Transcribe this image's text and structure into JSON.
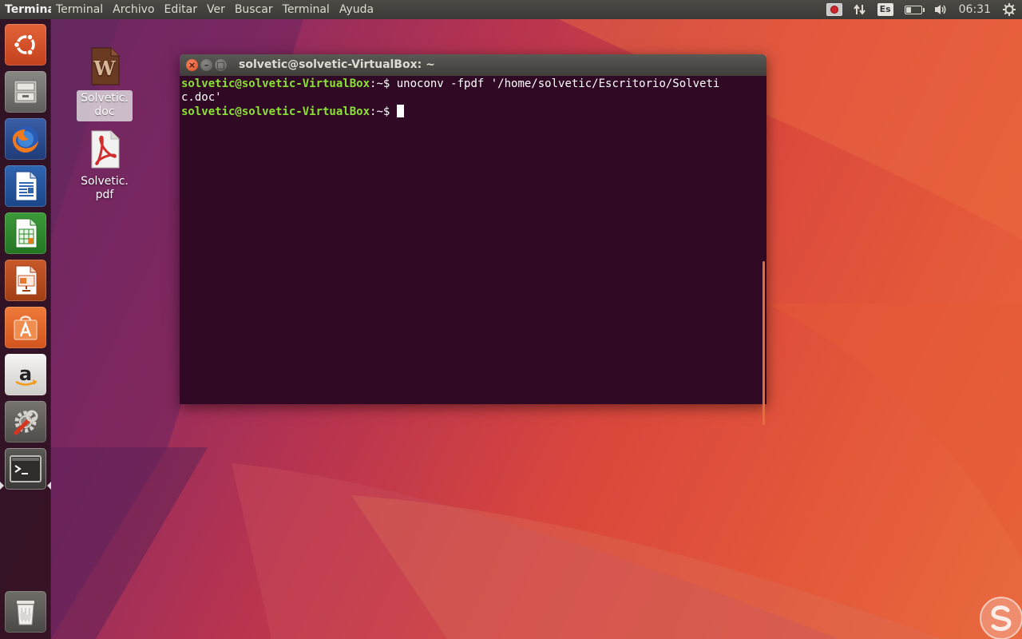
{
  "top_panel": {
    "app_title": "Terminal",
    "menu": [
      "Terminal",
      "Archivo",
      "Editar",
      "Ver",
      "Buscar",
      "Terminal",
      "Ayuda"
    ],
    "tray": {
      "record_icon": "record-icon",
      "network_icon": "network-updown-icon",
      "keyboard_layout": "Es",
      "battery_icon": "battery-icon",
      "volume_icon": "volume-icon",
      "clock": "06:31",
      "settings_icon": "gear-power-icon"
    }
  },
  "launcher": {
    "items": [
      {
        "name": "ubuntu-dash",
        "icon": "ubuntu-logo-icon"
      },
      {
        "name": "files",
        "icon": "file-cabinet-icon"
      },
      {
        "name": "firefox",
        "icon": "firefox-icon"
      },
      {
        "name": "writer",
        "icon": "libreoffice-writer-icon"
      },
      {
        "name": "calc",
        "icon": "libreoffice-calc-icon"
      },
      {
        "name": "impress",
        "icon": "libreoffice-impress-icon"
      },
      {
        "name": "software-center",
        "icon": "software-bag-icon"
      },
      {
        "name": "amazon",
        "icon": "amazon-icon"
      },
      {
        "name": "system-settings",
        "icon": "settings-wrench-icon"
      },
      {
        "name": "terminal",
        "icon": "terminal-icon",
        "active": true
      },
      {
        "name": "trash",
        "icon": "trash-icon"
      }
    ]
  },
  "desktop": {
    "icons": [
      {
        "label": "Solvetic.\ndoc",
        "line1": "Solvetic.",
        "line2": "doc",
        "icon": "word-document-icon",
        "selected": true
      },
      {
        "label": "Solvetic.\npdf",
        "line1": "Solvetic.",
        "line2": "pdf",
        "icon": "pdf-document-icon",
        "selected": false
      }
    ]
  },
  "terminal": {
    "title": "solvetic@solvetic-VirtualBox: ~",
    "lines": [
      {
        "prompt": "solvetic@solvetic-VirtualBox",
        "path": ":~$ ",
        "command": "unoconv -fpdf '/home/solvetic/Escritorio/Solveti"
      },
      {
        "prompt": "",
        "path": "",
        "command": "c.doc'"
      },
      {
        "prompt": "solvetic@solvetic-VirtualBox",
        "path": ":~$ ",
        "command": ""
      }
    ],
    "colors": {
      "background": "#300a24",
      "prompt": "#8ae234",
      "text": "#ffffff"
    }
  },
  "watermark": {
    "icon": "solvetic-logo-icon"
  }
}
